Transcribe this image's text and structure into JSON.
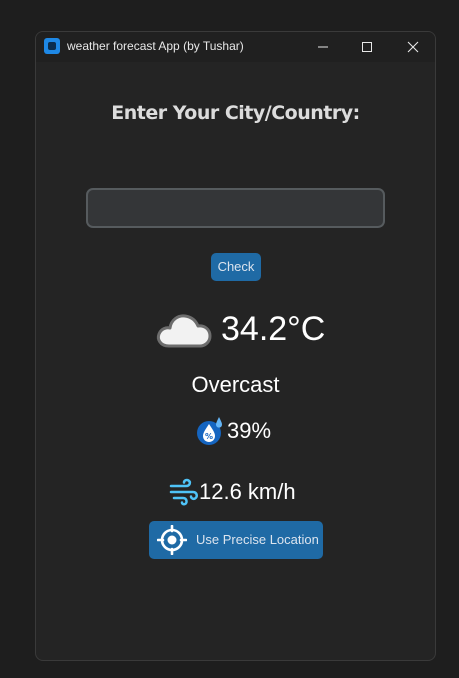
{
  "window": {
    "title": "weather forecast App (by Tushar)"
  },
  "main": {
    "heading": "Enter Your City/Country:",
    "city_input": {
      "value": "",
      "placeholder": ""
    },
    "check_label": "Check",
    "weather": {
      "icon": "cloud-icon",
      "temperature": "34.2°C",
      "condition": "Overcast",
      "humidity": "39%",
      "wind": "12.6 km/h"
    },
    "location_button_label": "Use Precise Location"
  },
  "colors": {
    "accent": "#1f6aa5",
    "background": "#242424",
    "text": "#ffffff"
  }
}
